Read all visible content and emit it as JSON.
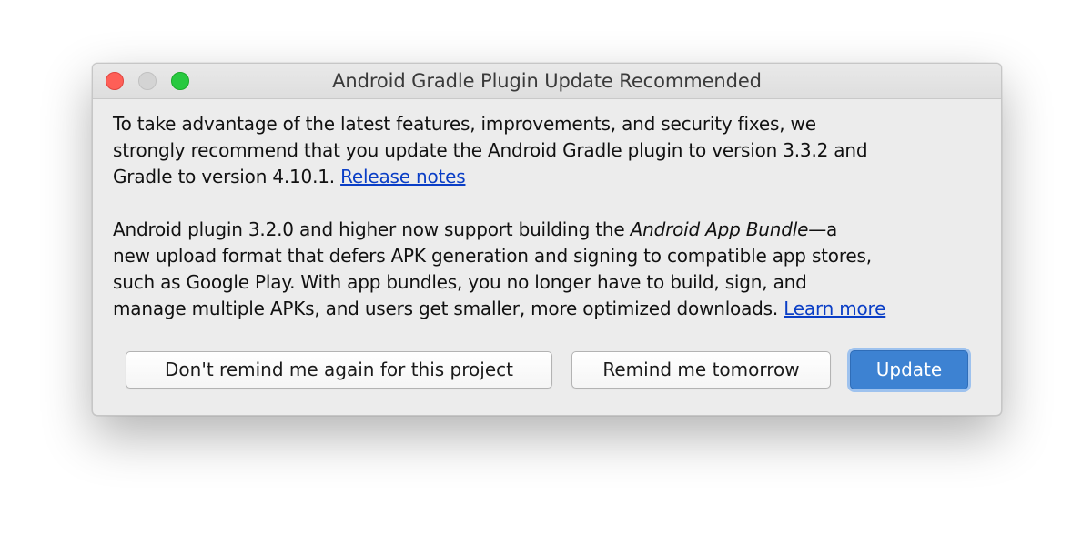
{
  "window": {
    "title": "Android Gradle Plugin Update Recommended"
  },
  "message": {
    "para1_lines": [
      "To take advantage of the latest features, improvements, and security fixes, we",
      "strongly recommend that you update the Android Gradle plugin to version 3.3.2 and"
    ],
    "para1_last_prefix": "Gradle to version 4.10.1. ",
    "release_notes_link": "Release notes",
    "para2_line1_prefix": "Android plugin 3.2.0 and higher now support building the ",
    "para2_italic": "Android App Bundle",
    "para2_line1_suffix": "—a",
    "para2_lines": [
      "new upload format that defers APK generation and signing to compatible app stores,",
      "such as Google Play. With app bundles, you no longer have to build, sign, and"
    ],
    "para2_last_prefix": "manage multiple APKs, and users get smaller, more optimized downloads. ",
    "learn_more_link": "Learn more"
  },
  "buttons": {
    "dont_remind": "Don't remind me again for this project",
    "remind_tomorrow": "Remind me tomorrow",
    "update": "Update"
  },
  "colors": {
    "link": "#0a3ec6",
    "primary_button": "#3d82d2",
    "close": "#fe5f57",
    "zoom": "#28c940"
  }
}
